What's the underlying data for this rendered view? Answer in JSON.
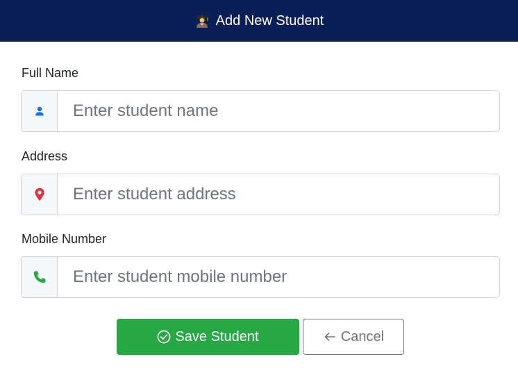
{
  "header": {
    "title": "Add New Student",
    "icon": "student-icon",
    "background": "#0b1f57"
  },
  "form": {
    "fields": [
      {
        "label": "Full Name",
        "placeholder": "Enter student name",
        "value": "",
        "icon": "user-icon",
        "icon_color": "#0d6efd"
      },
      {
        "label": "Address",
        "placeholder": "Enter student address",
        "value": "",
        "icon": "map-marker-icon",
        "icon_color": "#dc3545"
      },
      {
        "label": "Mobile Number",
        "placeholder": "Enter student mobile number",
        "value": "",
        "icon": "phone-icon",
        "icon_color": "#28a745"
      }
    ]
  },
  "actions": {
    "save_label": "Save Student",
    "save_icon": "check-circle-icon",
    "save_color": "#28a745",
    "cancel_label": "Cancel",
    "cancel_icon": "arrow-left-icon"
  }
}
